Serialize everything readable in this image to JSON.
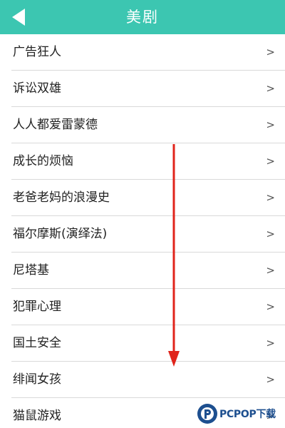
{
  "header": {
    "title": "美剧",
    "back_icon": "back-arrow-icon",
    "bg_color": "#3cc6b1"
  },
  "list": {
    "items": [
      {
        "label": "广告狂人",
        "chevron": ">"
      },
      {
        "label": "诉讼双雄",
        "chevron": ">"
      },
      {
        "label": "人人都爱雷蒙德",
        "chevron": ">"
      },
      {
        "label": "成长的烦恼",
        "chevron": ">"
      },
      {
        "label": "老爸老妈的浪漫史",
        "chevron": ">"
      },
      {
        "label": "福尔摩斯(演绎法)",
        "chevron": ">"
      },
      {
        "label": "尼塔基",
        "chevron": ">"
      },
      {
        "label": "犯罪心理",
        "chevron": ">"
      },
      {
        "label": "国土安全",
        "chevron": ">"
      },
      {
        "label": "绯闻女孩",
        "chevron": ">"
      },
      {
        "label": "猫鼠游戏",
        "chevron": ">"
      }
    ]
  },
  "overlay": {
    "scroll_arrow_color": "#e0241b"
  },
  "watermark": {
    "text": "PCPOP下载",
    "color": "#1d4f8f"
  }
}
